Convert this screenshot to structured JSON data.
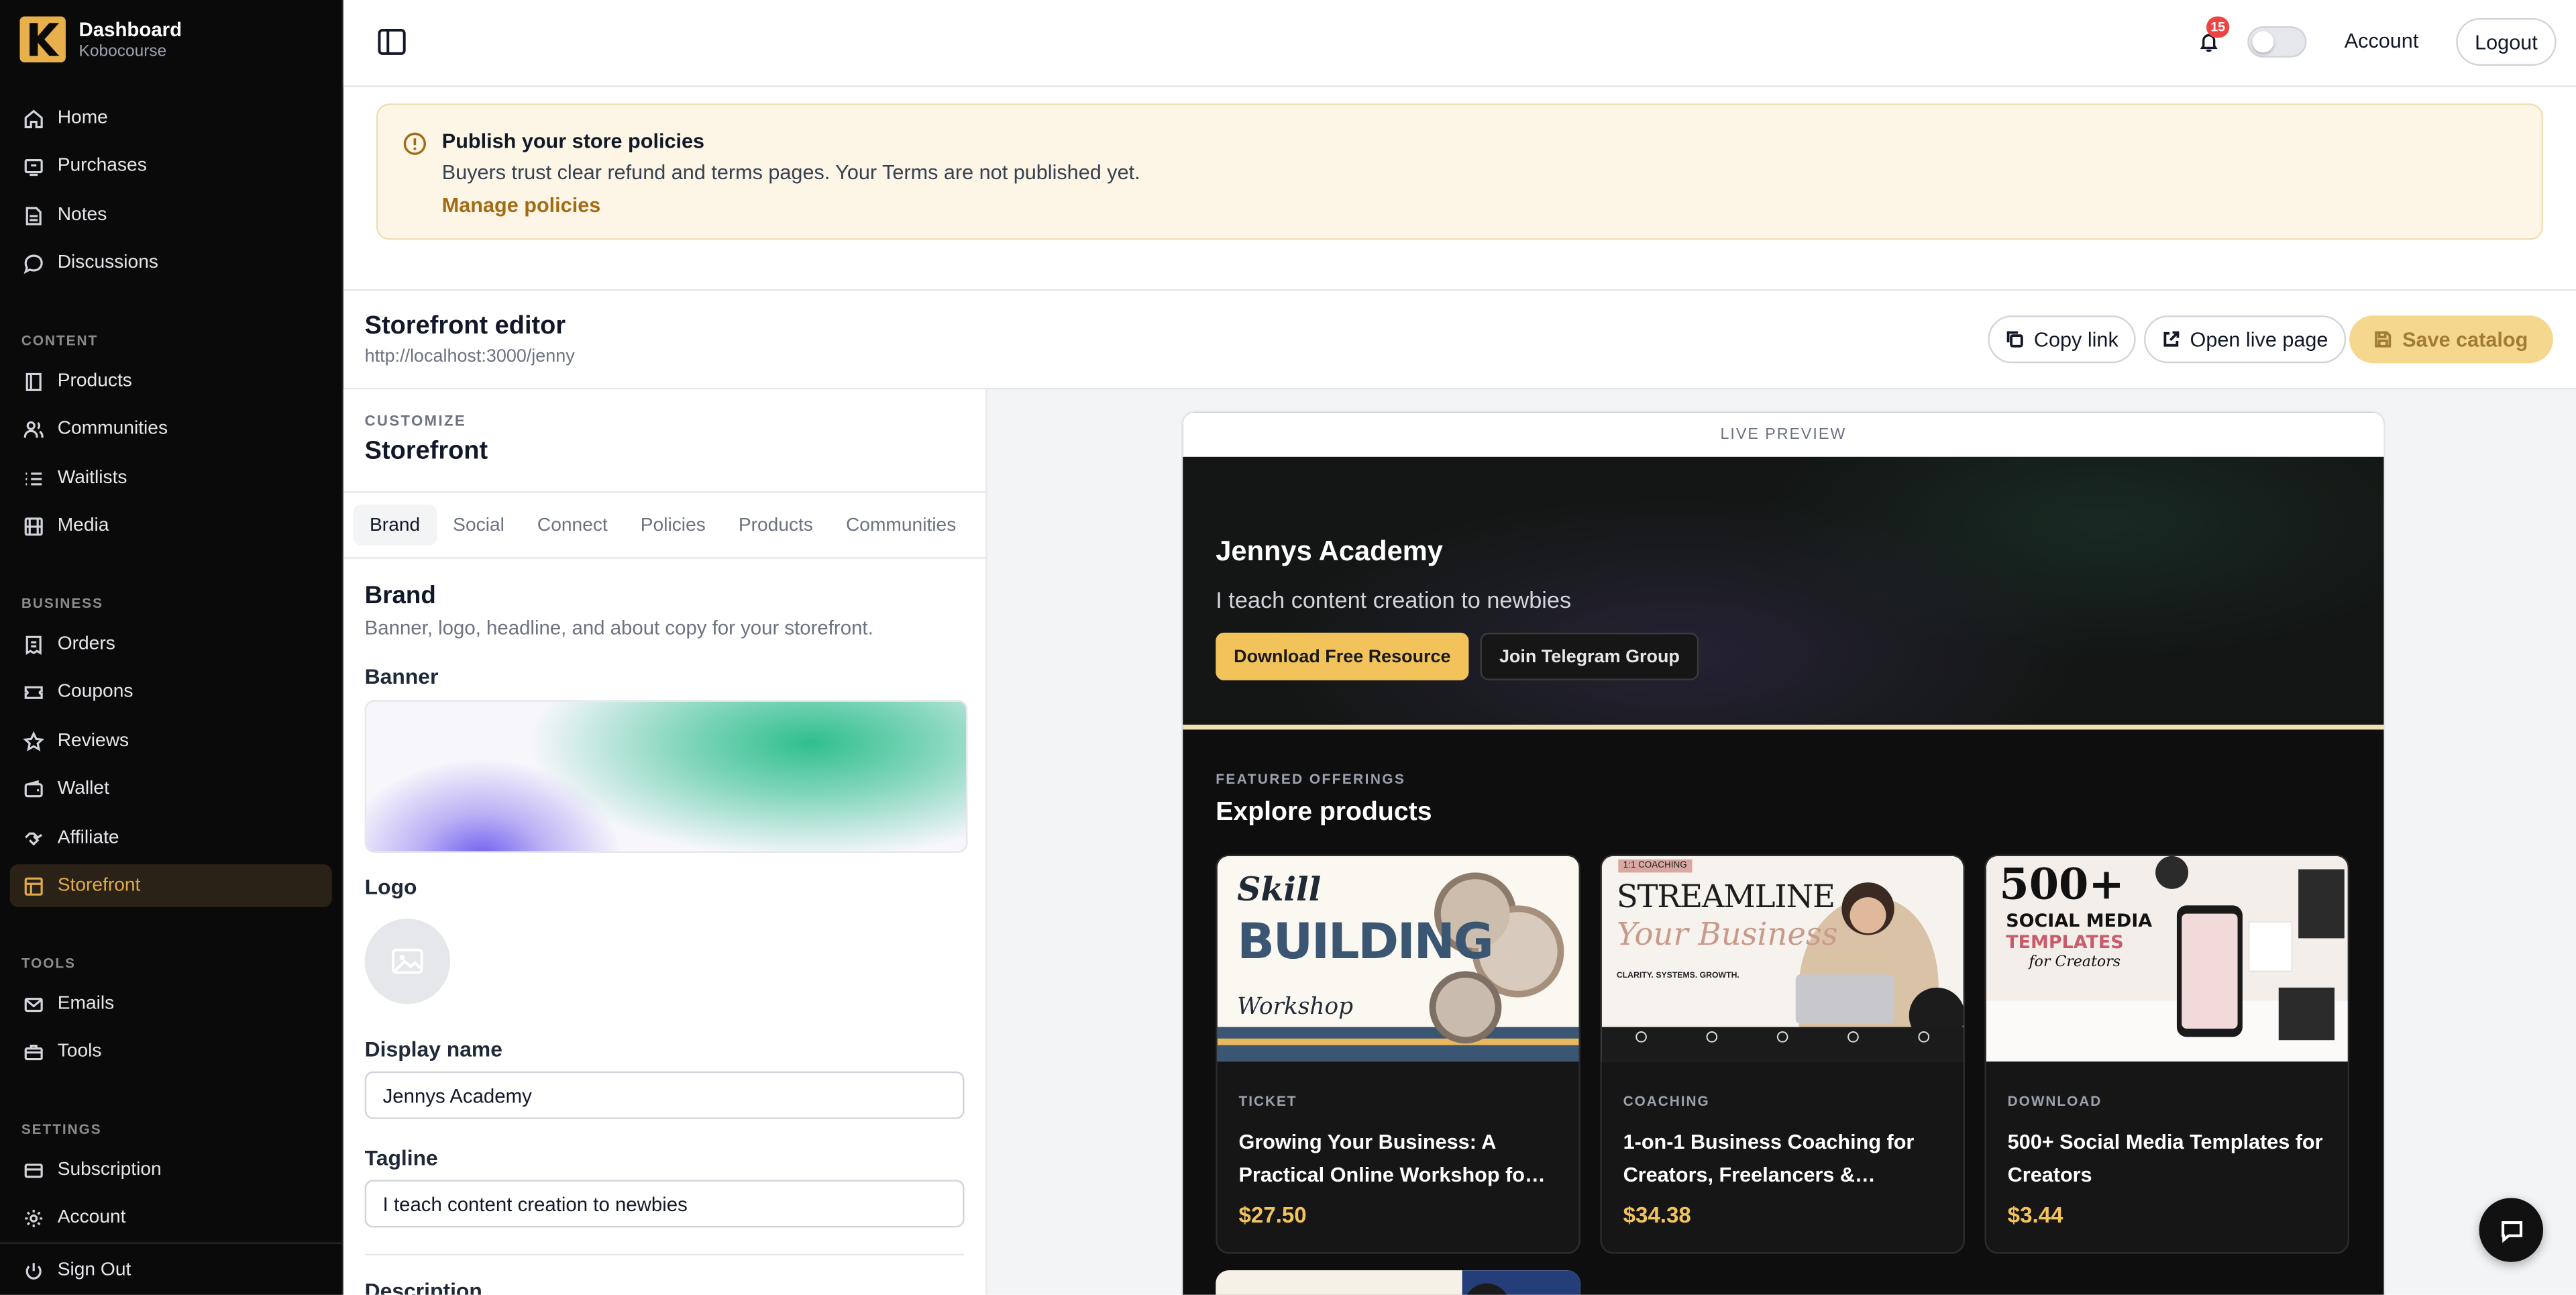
{
  "sidebar": {
    "brand_title": "Dashboard",
    "brand_subtitle": "Kobocourse",
    "items": [
      {
        "label": "Home",
        "icon": "home-icon"
      },
      {
        "label": "Purchases",
        "icon": "receipt-icon"
      },
      {
        "label": "Notes",
        "icon": "note-icon"
      },
      {
        "label": "Discussions",
        "icon": "chat-bubble-icon"
      }
    ],
    "sections": {
      "content": "CONTENT",
      "business": "BUSINESS",
      "tools": "TOOLS",
      "settings": "SETTINGS"
    },
    "content_items": [
      {
        "label": "Products",
        "icon": "book-icon"
      },
      {
        "label": "Communities",
        "icon": "users-icon"
      },
      {
        "label": "Waitlists",
        "icon": "list-icon"
      },
      {
        "label": "Media",
        "icon": "film-icon"
      }
    ],
    "business_items": [
      {
        "label": "Orders",
        "icon": "orders-icon"
      },
      {
        "label": "Coupons",
        "icon": "ticket-icon"
      },
      {
        "label": "Reviews",
        "icon": "star-icon"
      },
      {
        "label": "Wallet",
        "icon": "wallet-icon"
      },
      {
        "label": "Affiliate",
        "icon": "handshake-icon"
      },
      {
        "label": "Storefront",
        "icon": "store-icon",
        "active": true
      }
    ],
    "tools_items": [
      {
        "label": "Emails",
        "icon": "mail-icon"
      },
      {
        "label": "Tools",
        "icon": "tools-icon"
      }
    ],
    "settings_items": [
      {
        "label": "Subscription",
        "icon": "card-icon"
      },
      {
        "label": "Account",
        "icon": "gear-icon"
      }
    ],
    "sign_out": "Sign Out",
    "active_color": "#e0a94a"
  },
  "header": {
    "notification_count": "15",
    "account": "Account",
    "logout": "Logout"
  },
  "notice": {
    "title": "Publish your store policies",
    "text": "Buyers trust clear refund and terms pages. Your Terms are not published yet.",
    "link": "Manage policies"
  },
  "editor": {
    "title": "Storefront editor",
    "url": "http://localhost:3000/jenny",
    "copy_link": "Copy link",
    "open_live": "Open live page",
    "save_catalog": "Save catalog"
  },
  "form": {
    "eyebrow": "CUSTOMIZE",
    "heading": "Storefront",
    "tabs": [
      "Brand",
      "Social",
      "Connect",
      "Policies",
      "Products",
      "Communities"
    ],
    "active_tab": "Brand",
    "section_title": "Brand",
    "section_desc": "Banner, logo, headline, and about copy for your storefront.",
    "banner_label": "Banner",
    "logo_label": "Logo",
    "display_name_label": "Display name",
    "display_name_value": "Jennys Academy",
    "tagline_label": "Tagline",
    "tagline_value": "I teach content creation to newbies",
    "description_label": "Description"
  },
  "preview": {
    "label": "LIVE PREVIEW",
    "store_name": "Jennys Academy",
    "tagline": "I teach content creation to newbies",
    "cta_primary": "Download Free Resource",
    "cta_secondary": "Join Telegram Group",
    "featured_label": "FEATURED OFFERINGS",
    "featured_title": "Explore products",
    "accent_color": "#f2c35b",
    "products": [
      {
        "type": "TICKET",
        "title": "Growing Your Business: A Practical Online Workshop fo…",
        "price": "$27.50",
        "image_text": {
          "line1": "Skill",
          "line2": "BUILDING",
          "line3": "Workshop"
        }
      },
      {
        "type": "COACHING",
        "title": "1-on-1 Business Coaching for Creators, Freelancers &…",
        "price": "$34.38",
        "image_text": {
          "tag": "1:1 COACHING",
          "line1": "STREAMLINE",
          "line2": "Your Business",
          "line3": "CLARITY. SYSTEMS. GROWTH."
        }
      },
      {
        "type": "DOWNLOAD",
        "title": "500+ Social Media Templates for Creators",
        "price": "$3.44",
        "image_text": {
          "line1": "500+",
          "line2": "SOCIAL MEDIA",
          "line3": "TEMPLATES",
          "line4": "for Creators"
        }
      }
    ]
  }
}
